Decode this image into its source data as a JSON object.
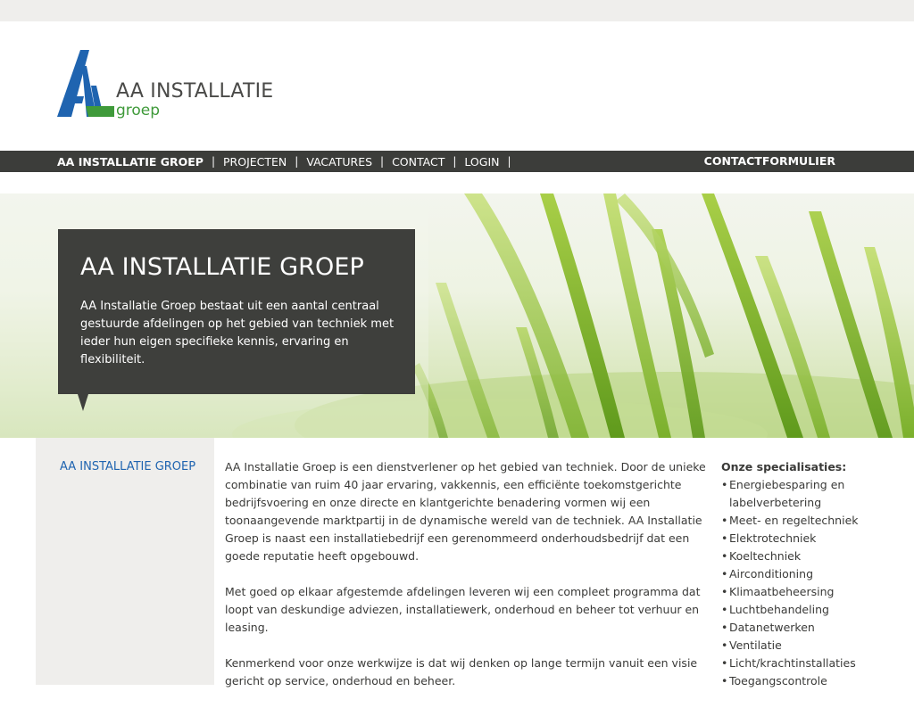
{
  "colors": {
    "nav_bg": "#3c3d3a",
    "hero_box_bg": "#3e3f3c",
    "logo_blue": "#1f64b0",
    "logo_green": "#3f9a3a",
    "link_blue": "#1f64b0",
    "side_bg": "#efeeec"
  },
  "logo": {
    "title": "AA INSTALLATIE",
    "subtitle": "groep",
    "icon": "aa-logo-icon"
  },
  "nav": {
    "items": [
      {
        "label": "AA INSTALLATIE GROEP",
        "active": true
      },
      {
        "label": "PROJECTEN"
      },
      {
        "label": "VACATURES"
      },
      {
        "label": "CONTACT"
      },
      {
        "label": "LOGIN"
      }
    ],
    "right_label": "CONTACTFORMULIER"
  },
  "hero": {
    "title": "AA INSTALLATIE GROEP",
    "text": "AA Installatie Groep bestaat uit een aantal centraal gestuurde afdelingen op het gebied van techniek met ieder hun eigen specifieke kennis, ervaring en flexibiliteit."
  },
  "sidebar": {
    "title": "AA INSTALLATIE GROEP"
  },
  "main": {
    "paragraphs": [
      "AA Installatie Groep is een dienstverlener op het gebied van techniek. Door de unieke combinatie van ruim 40 jaar ervaring, vakkennis, een efficiënte toekomstgerichte bedrijfsvoering en onze directe en klantgerichte benadering vormen wij een toonaangevende marktpartij in de dynamische wereld van de techniek. AA Installatie Groep is naast een installatiebedrijf een gerenommeerd onderhoudsbedrijf dat een goede reputatie heeft opgebouwd.",
      "Met goed op elkaar afgestemde afdelingen leveren wij een compleet programma dat loopt van deskundige adviezen, installatiewerk, onderhoud en beheer tot verhuur en leasing.",
      "Kenmerkend voor onze werkwijze is dat wij denken op lange termijn vanuit een visie gericht op service, onderhoud en beheer."
    ]
  },
  "specialisaties": {
    "title": "Onze specialisaties:",
    "items": [
      "Energiebesparing en labelverbetering",
      "Meet- en regeltechniek",
      "Elektrotechniek",
      "Koeltechniek",
      "Airconditioning",
      "Klimaatbeheersing",
      "Luchtbehandeling",
      "Datanetwerken",
      "Ventilatie",
      "Licht/krachtinstallaties",
      "Toegangscontrole"
    ]
  }
}
